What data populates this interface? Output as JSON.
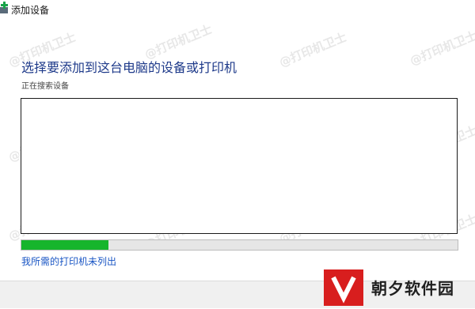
{
  "window": {
    "title": "添加设备",
    "icon": "add-device-icon"
  },
  "main": {
    "heading": "选择要添加到这台电脑的设备或打印机",
    "status": "正在搜索设备",
    "device_list": [],
    "progress_percent": 20,
    "progress_color": "#16b52c",
    "missing_printer_link": "我所需的打印机未列出"
  },
  "watermark": {
    "text": "@打印机卫士"
  },
  "logo": {
    "text": "朝夕软件园",
    "brand_color": "#d81e1e"
  }
}
